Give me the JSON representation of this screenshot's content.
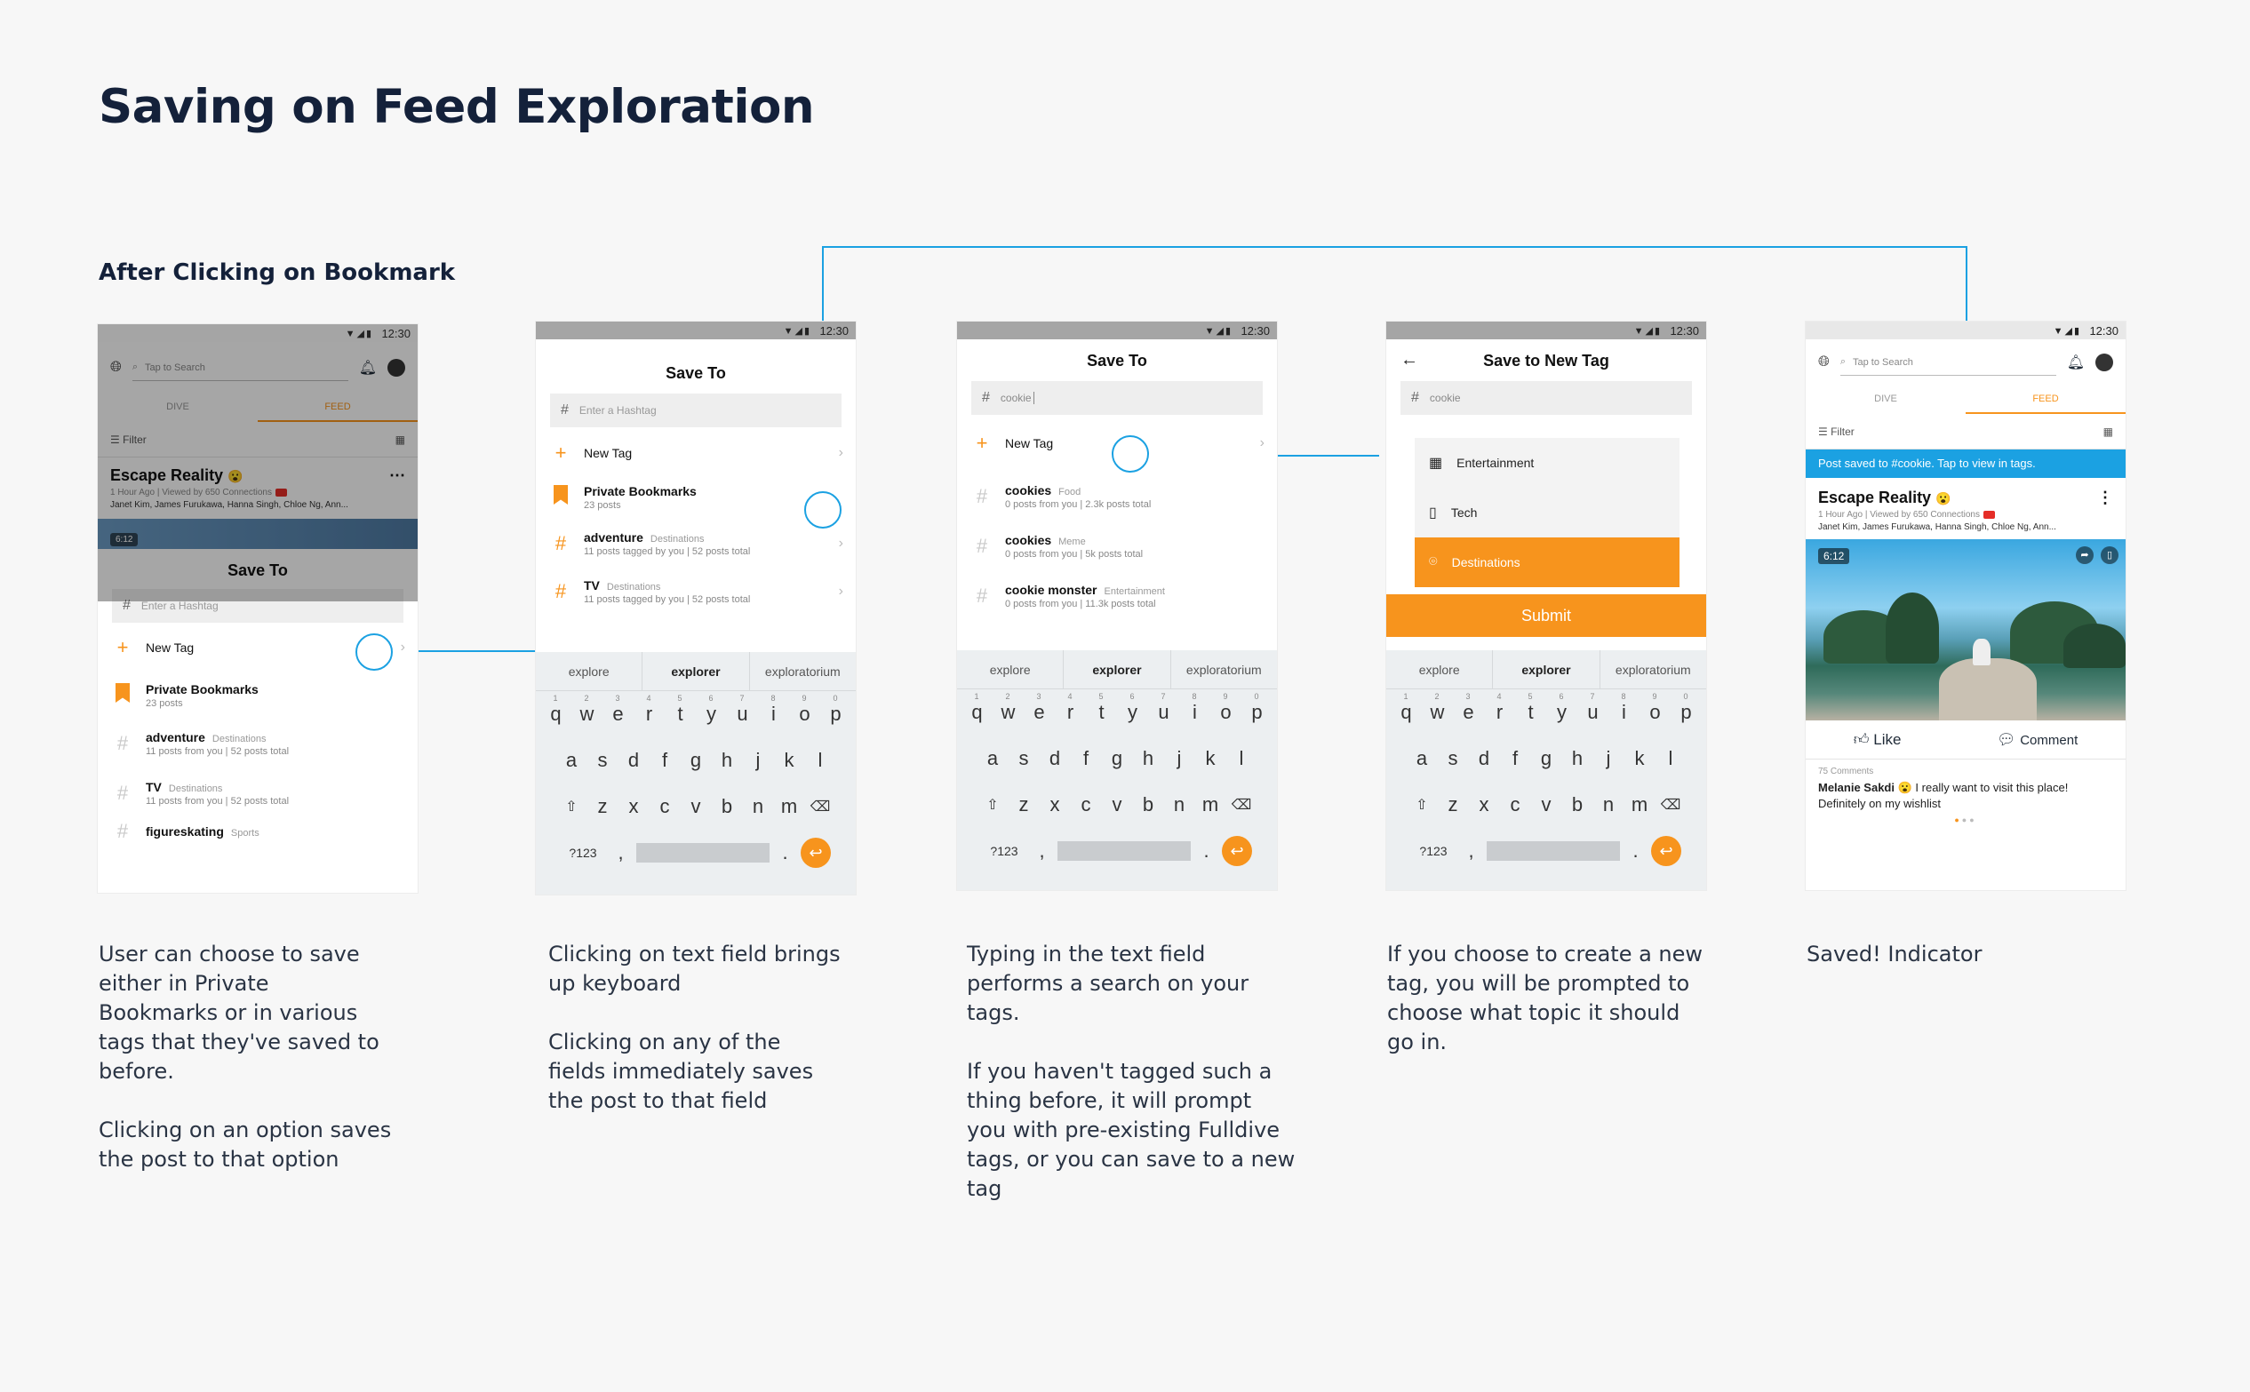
{
  "page": {
    "title": "Saving on Feed Exploration",
    "subtitle": "After Clicking on Bookmark"
  },
  "status": {
    "time": "12:30"
  },
  "feed": {
    "search_placeholder": "Tap to Search",
    "tabs": [
      "DIVE",
      "FEED"
    ],
    "filter": "Filter",
    "post": {
      "title": "Escape Reality",
      "meta": "1 Hour Ago | Viewed by 650 Connections",
      "names": "Janet Kim, James Furukawa, Hanna Singh, Chloe Ng, Ann...",
      "duration": "6:12"
    }
  },
  "save_sheet": {
    "title": "Save To",
    "placeholder": "Enter a Hashtag",
    "new_tag": "New Tag",
    "private": {
      "label": "Private Bookmarks",
      "sub": "23 posts"
    },
    "tags": [
      {
        "name": "adventure",
        "cat": "Destinations",
        "sub1": "11 posts from you | 52 posts total",
        "sub2": "11 posts tagged by you | 52 posts total"
      },
      {
        "name": "TV",
        "cat": "Destinations",
        "sub1": "11 posts from you | 52 posts total",
        "sub2": "11 posts tagged by you | 52 posts total"
      },
      {
        "name": "figureskating",
        "cat": "Sports"
      }
    ]
  },
  "search": {
    "query": "cookie",
    "results": [
      {
        "name": "cookies",
        "cat": "Food",
        "sub": "0 posts from you | 2.3k posts total"
      },
      {
        "name": "cookies",
        "cat": "Meme",
        "sub": "0 posts from you | 5k posts total"
      },
      {
        "name": "cookie monster",
        "cat": "Entertainment",
        "sub": "0 posts from you | 11.3k posts total"
      }
    ]
  },
  "keyboard": {
    "suggestions": [
      "explore",
      "explorer",
      "exploratorium"
    ],
    "row1": [
      "q",
      "w",
      "e",
      "r",
      "t",
      "y",
      "u",
      "i",
      "o",
      "p"
    ],
    "row1_nums": [
      "1",
      "2",
      "3",
      "4",
      "5",
      "6",
      "7",
      "8",
      "9",
      "0"
    ],
    "row2": [
      "a",
      "s",
      "d",
      "f",
      "g",
      "h",
      "j",
      "k",
      "l"
    ],
    "row3": [
      "z",
      "x",
      "c",
      "v",
      "b",
      "n",
      "m"
    ],
    "sym": "?123",
    "comma": ",",
    "period": "."
  },
  "new_tag": {
    "title": "Save to New Tag",
    "topics": [
      "Entertainment",
      "Tech",
      "Destinations"
    ],
    "submit": "Submit"
  },
  "saved": {
    "banner": "Post saved to #cookie. Tap to view in tags.",
    "like": "Like",
    "comment": "Comment",
    "comments_count": "75 Comments",
    "commenter": "Melanie Sakdi",
    "comment_text": "I really want to visit this place! Definitely on my wishlist"
  },
  "descriptions": {
    "d1": [
      "User can choose to save either in Private Bookmarks or in various tags that they've saved to before.",
      "Clicking on an option saves the post to that option"
    ],
    "d2": [
      "Clicking on text field brings up keyboard",
      "Clicking on any of the fields immediately saves the post to that field"
    ],
    "d3": [
      "Typing in the text field performs a search on your tags.",
      "If you haven't tagged such a thing before, it will prompt you with pre-existing Fulldive tags, or you can save to a new tag"
    ],
    "d4": [
      "If you choose to create a new tag, you will be prompted to choose what topic it should go in."
    ],
    "d5": [
      "Saved! Indicator"
    ]
  },
  "colors": {
    "accent": "#f7941d",
    "link": "#1ba1e2",
    "title": "#14213a"
  }
}
